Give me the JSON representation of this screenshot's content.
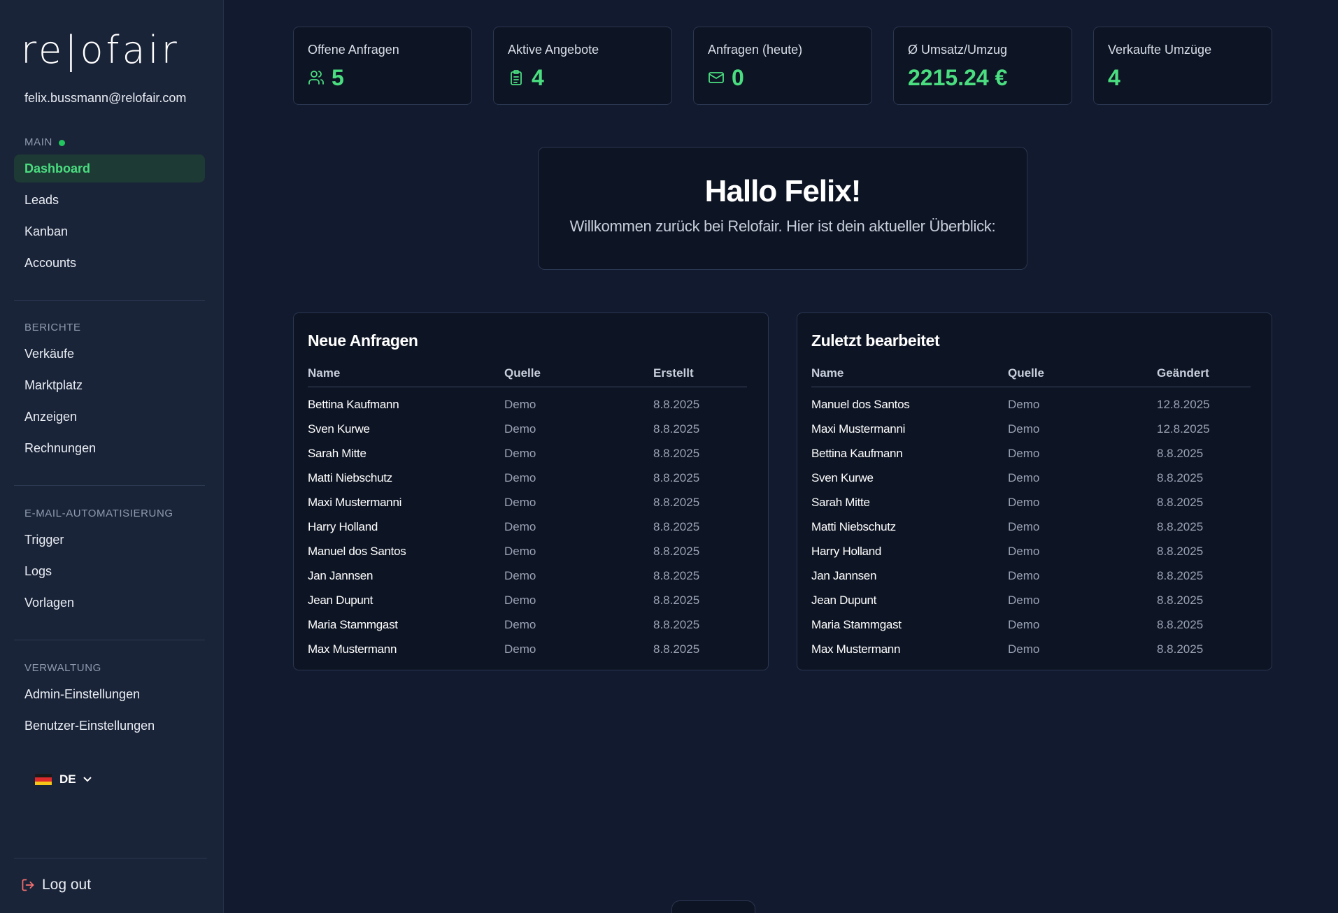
{
  "app": {
    "logo": "re|ofair",
    "user_email": "felix.bussmann@relofair.com"
  },
  "sidebar": {
    "sections": [
      {
        "label": "MAIN",
        "items": [
          "Dashboard",
          "Leads",
          "Kanban",
          "Accounts"
        ]
      },
      {
        "label": "BERICHTE",
        "items": [
          "Verkäufe",
          "Marktplatz",
          "Anzeigen",
          "Rechnungen"
        ]
      },
      {
        "label": "E-MAIL-AUTOMATISIERUNG",
        "items": [
          "Trigger",
          "Logs",
          "Vorlagen"
        ]
      },
      {
        "label": "VERWALTUNG",
        "items": [
          "Admin-Einstellungen",
          "Benutzer-Einstellungen"
        ]
      }
    ],
    "active_item": "Dashboard",
    "language": "DE",
    "logout_label": "Log out"
  },
  "stats": [
    {
      "title": "Offene Anfragen",
      "value": "5",
      "icon": "users-icon"
    },
    {
      "title": "Aktive Angebote",
      "value": "4",
      "icon": "clipboard-icon"
    },
    {
      "title": "Anfragen (heute)",
      "value": "0",
      "icon": "mail-icon"
    },
    {
      "title": "Ø Umsatz/Umzug",
      "value": "2215.24 €",
      "icon": ""
    },
    {
      "title": "Verkaufte Umzüge",
      "value": "4",
      "icon": ""
    }
  ],
  "welcome": {
    "title": "Hallo Felix!",
    "subtitle": "Willkommen zurück bei Relofair. Hier ist dein aktueller Überblick:"
  },
  "new_requests": {
    "title": "Neue Anfragen",
    "columns": [
      "Name",
      "Quelle",
      "Erstellt"
    ],
    "rows": [
      [
        "Bettina Kaufmann",
        "Demo",
        "8.8.2025"
      ],
      [
        "Sven Kurwe",
        "Demo",
        "8.8.2025"
      ],
      [
        "Sarah Mitte",
        "Demo",
        "8.8.2025"
      ],
      [
        "Matti Niebschutz",
        "Demo",
        "8.8.2025"
      ],
      [
        "Maxi Mustermanni",
        "Demo",
        "8.8.2025"
      ],
      [
        "Harry Holland",
        "Demo",
        "8.8.2025"
      ],
      [
        "Manuel dos Santos",
        "Demo",
        "8.8.2025"
      ],
      [
        "Jan Jannsen",
        "Demo",
        "8.8.2025"
      ],
      [
        "Jean Dupunt",
        "Demo",
        "8.8.2025"
      ],
      [
        "Maria Stammgast",
        "Demo",
        "8.8.2025"
      ],
      [
        "Max Mustermann",
        "Demo",
        "8.8.2025"
      ]
    ]
  },
  "recently_edited": {
    "title": "Zuletzt bearbeitet",
    "columns": [
      "Name",
      "Quelle",
      "Geändert"
    ],
    "rows": [
      [
        "Manuel dos Santos",
        "Demo",
        "12.8.2025"
      ],
      [
        "Maxi Mustermanni",
        "Demo",
        "12.8.2025"
      ],
      [
        "Bettina Kaufmann",
        "Demo",
        "8.8.2025"
      ],
      [
        "Sven Kurwe",
        "Demo",
        "8.8.2025"
      ],
      [
        "Sarah Mitte",
        "Demo",
        "8.8.2025"
      ],
      [
        "Matti Niebschutz",
        "Demo",
        "8.8.2025"
      ],
      [
        "Harry Holland",
        "Demo",
        "8.8.2025"
      ],
      [
        "Jan Jannsen",
        "Demo",
        "8.8.2025"
      ],
      [
        "Jean Dupunt",
        "Demo",
        "8.8.2025"
      ],
      [
        "Maria Stammgast",
        "Demo",
        "8.8.2025"
      ],
      [
        "Max Mustermann",
        "Demo",
        "8.8.2025"
      ]
    ]
  },
  "colors": {
    "accent": "#4ade80",
    "background": "#111a2e",
    "sidebar": "#1a2438",
    "card": "#0d1423",
    "logout_icon": "#f87171"
  }
}
